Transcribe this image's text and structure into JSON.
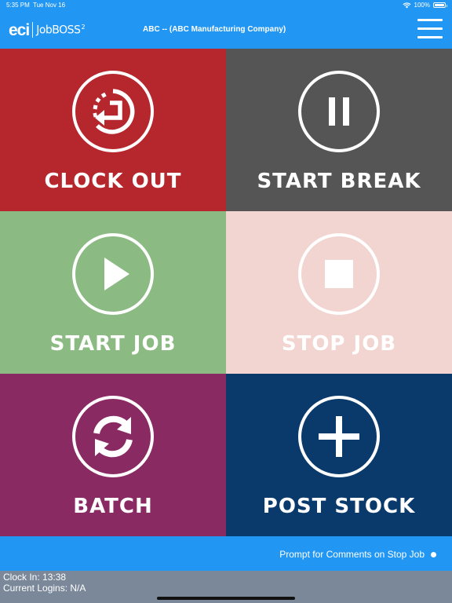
{
  "status_bar": {
    "time": "5:35 PM",
    "date": "Tue Nov 16",
    "battery": "100%",
    "wifi_icon": "wifi-icon",
    "battery_icon": "battery-icon"
  },
  "header": {
    "logo_eci": "eci",
    "logo_product": "JobBOSS",
    "logo_superscript": "2",
    "company": "ABC -- (ABC Manufacturing Company)",
    "menu_icon": "hamburger-menu-icon"
  },
  "tiles": [
    {
      "label": "CLOCK OUT",
      "icon": "clock-out-icon",
      "color": "#b5272d"
    },
    {
      "label": "START BREAK",
      "icon": "pause-icon",
      "color": "#555555"
    },
    {
      "label": "START JOB",
      "icon": "play-icon",
      "color": "#8bba82"
    },
    {
      "label": "STOP JOB",
      "icon": "stop-icon",
      "color": "#f2d4d0"
    },
    {
      "label": "BATCH",
      "icon": "refresh-icon",
      "color": "#8a2a63"
    },
    {
      "label": "POST STOCK",
      "icon": "plus-icon",
      "color": "#0a3a6c"
    }
  ],
  "footer": {
    "prompt_label": "Prompt for Comments on Stop Job",
    "prompt_icon": "dot-indicator-icon"
  },
  "info": {
    "clock_in": "Clock In: 13:38",
    "current_logins": "Current Logins: N/A"
  },
  "colors": {
    "brand_blue": "#2196f3",
    "info_gray": "#7a889a"
  }
}
